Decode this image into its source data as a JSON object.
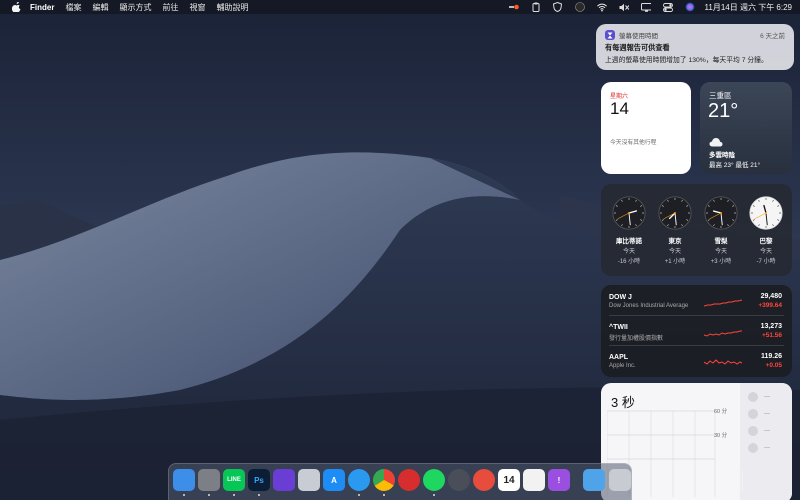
{
  "menubar": {
    "app_name": "Finder",
    "items": [
      "檔案",
      "編輯",
      "顯示方式",
      "前往",
      "視窗",
      "輔助說明"
    ],
    "clock": "11月14日 週六 下午 6:29",
    "icons": [
      "record-icon",
      "clipboard-icon",
      "shield-icon",
      "moon-icon",
      "wifi-icon",
      "mute-icon",
      "display-icon",
      "control-center-icon",
      "siri-icon",
      "notification-center-icon"
    ]
  },
  "notification": {
    "app": "螢幕使用時間",
    "age": "6 天之前",
    "title": "有每週報告可供查看",
    "body": "上週的螢幕使用時間增加了 130%，每天平均 7 分鐘。",
    "icon": "hourglass-icon"
  },
  "calendar": {
    "weekday": "星期六",
    "day": "14",
    "no_events": "今天沒有其他行程"
  },
  "weather": {
    "location": "三重區",
    "temp": "21°",
    "condition": "多雲時陰",
    "hilo": "最高 23° 最低 21°",
    "icon": "cloud-icon"
  },
  "world_clocks": [
    {
      "city": "庫比蒂諾",
      "rel": "今天",
      "offset": "-16 小時",
      "hour": 2,
      "minute": 29,
      "face": "dark"
    },
    {
      "city": "東京",
      "rel": "今天",
      "offset": "+1 小時",
      "hour": 7,
      "minute": 29,
      "face": "dark"
    },
    {
      "city": "雪梨",
      "rel": "今天",
      "offset": "+3 小時",
      "hour": 9,
      "minute": 29,
      "face": "dark"
    },
    {
      "city": "巴黎",
      "rel": "今天",
      "offset": "-7 小時",
      "hour": 11,
      "minute": 29,
      "face": "light"
    }
  ],
  "stocks": [
    {
      "symbol": "DOW J",
      "name": "Dow Jones Industrial Average",
      "price": "29,480",
      "change": "+399.64"
    },
    {
      "symbol": "^TWII",
      "name": "發行量加權股價指數",
      "price": "13,273",
      "change": "+51.56"
    },
    {
      "symbol": "AAPL",
      "name": "Apple Inc.",
      "price": "119.26",
      "change": "+0.05"
    }
  ],
  "screen_time": {
    "total": "3 秒",
    "gridlines": [
      "60 分",
      "30 分"
    ],
    "side_placeholder": "—"
  },
  "colors": {
    "stock_change": "#ff453a",
    "calendar_weekday": "#e0302a"
  },
  "dock": {
    "apps": [
      {
        "name": "finder",
        "label": "",
        "color": "#3d8ee8",
        "running": true
      },
      {
        "name": "system-preferences",
        "label": "",
        "color": "#7d7f86",
        "running": true
      },
      {
        "name": "line",
        "label": "LINE",
        "color": "#06c755",
        "running": true
      },
      {
        "name": "photoshop",
        "label": "Ps",
        "color": "#0b1e36",
        "running": true
      },
      {
        "name": "siri",
        "label": "",
        "color": "#6a3dd4",
        "running": false
      },
      {
        "name": "launchpad",
        "label": "",
        "color": "#c8ccd4",
        "running": false
      },
      {
        "name": "app-store",
        "label": "A",
        "color": "#1d8cf5",
        "running": false
      },
      {
        "name": "safari",
        "label": "",
        "color": "#2a9af0",
        "running": true
      },
      {
        "name": "chrome",
        "label": "",
        "color": "#e8e8e8",
        "running": true
      },
      {
        "name": "photo-booth",
        "label": "",
        "color": "#d62e2e",
        "running": false
      },
      {
        "name": "spotify",
        "label": "",
        "color": "#1ed760",
        "running": true
      },
      {
        "name": "vpn",
        "label": "",
        "color": "#4a4e58",
        "running": false
      },
      {
        "name": "pocket",
        "label": "",
        "color": "#e84c3d",
        "running": false
      },
      {
        "name": "calendar",
        "label": "14",
        "color": "#ffffff",
        "running": false
      },
      {
        "name": "reminders",
        "label": "",
        "color": "#f2f2f2",
        "running": false
      },
      {
        "name": "feedback",
        "label": "!",
        "color": "#9a4fe0",
        "running": false
      },
      {
        "name": "downloads-folder",
        "label": "",
        "color": "#4fa3e8",
        "running": false
      },
      {
        "name": "trash",
        "label": "",
        "color": "#c8ccd2",
        "running": false
      }
    ]
  }
}
